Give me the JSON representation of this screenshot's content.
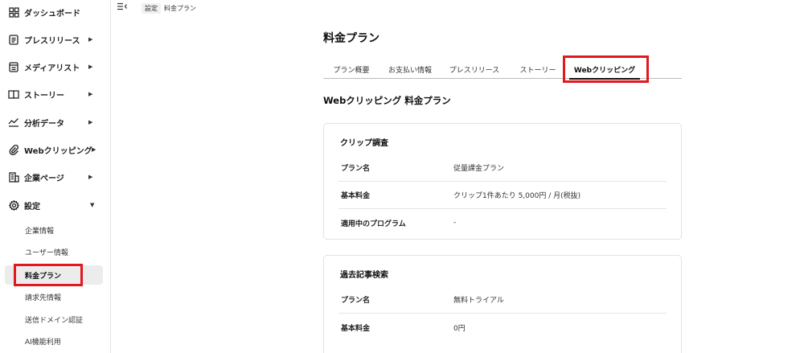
{
  "sidebar": {
    "items": [
      {
        "label": "ダッシュボード",
        "icon": "grid-icon"
      },
      {
        "label": "プレスリリース",
        "icon": "document-icon"
      },
      {
        "label": "メディアリスト",
        "icon": "media-list-icon"
      },
      {
        "label": "ストーリー",
        "icon": "book-icon"
      },
      {
        "label": "分析データ",
        "icon": "chart-line-icon"
      },
      {
        "label": "Webクリッピング",
        "icon": "paperclip-icon"
      },
      {
        "label": "企業ページ",
        "icon": "building-icon"
      },
      {
        "label": "設定",
        "icon": "gear-icon"
      }
    ],
    "sub_items": [
      {
        "label": "企業情報"
      },
      {
        "label": "ユーザー情報"
      },
      {
        "label": "料金プラン"
      },
      {
        "label": "請求先情報"
      },
      {
        "label": "送信ドメイン認証"
      },
      {
        "label": "AI機能利用"
      }
    ]
  },
  "breadcrumb": {
    "parent": "設定",
    "current": "料金プラン"
  },
  "page": {
    "title": "料金プラン"
  },
  "tabs": [
    {
      "label": "プラン概要"
    },
    {
      "label": "お支払い情報"
    },
    {
      "label": "プレスリリース"
    },
    {
      "label": "ストーリー"
    },
    {
      "label": "Webクリッピング"
    }
  ],
  "section_title": "Webクリッピング 料金プラン",
  "cards": [
    {
      "title": "クリップ調査",
      "rows": [
        {
          "label": "プラン名",
          "value": "従量課金プラン"
        },
        {
          "label": "基本料金",
          "value": "クリップ1件あたり 5,000円 / 月(税抜)"
        },
        {
          "label": "適用中のプログラム",
          "value": "-"
        }
      ]
    },
    {
      "title": "過去記事検索",
      "rows": [
        {
          "label": "プラン名",
          "value": "無料トライアル"
        },
        {
          "label": "基本料金",
          "value": "0円"
        }
      ]
    }
  ],
  "colors": {
    "highlight": "#e0191e",
    "active_bg": "#ececec"
  }
}
